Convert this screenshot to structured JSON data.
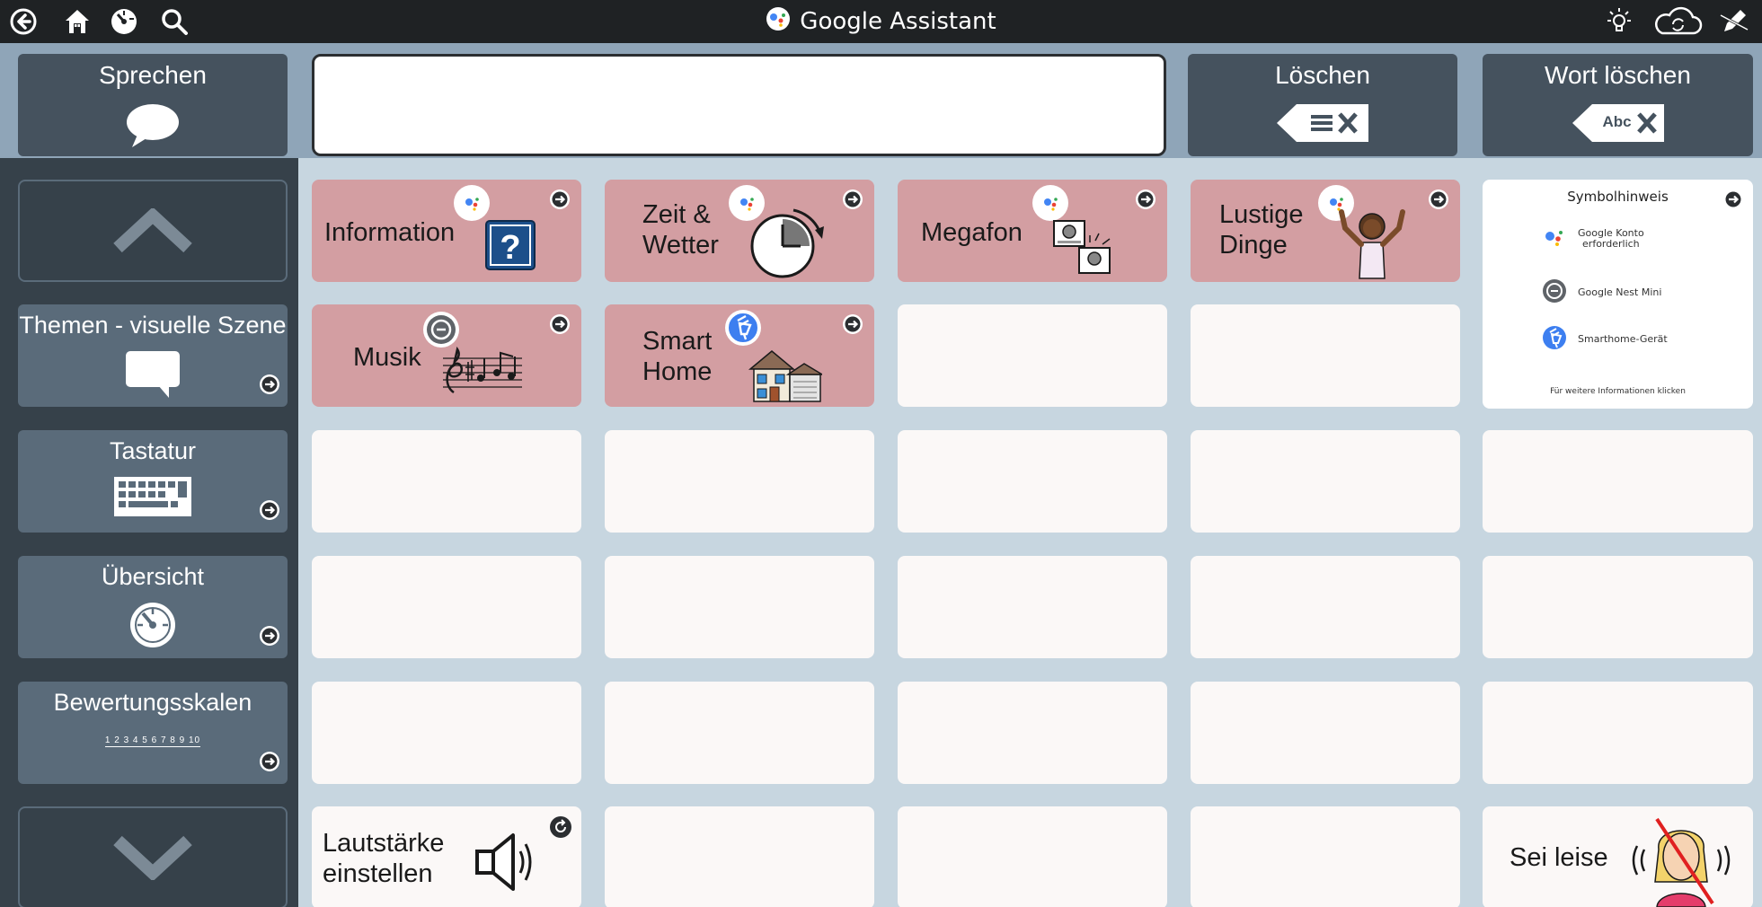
{
  "titlebar": {
    "title": "Google Assistant",
    "left_icons": [
      "back-arrow-icon",
      "home-icon",
      "dashboard-icon",
      "search-icon"
    ],
    "right_icons": [
      "lightbulb-icon",
      "cloud-sync-icon",
      "edit-pencil-icon"
    ]
  },
  "topbar": {
    "speak_label": "Sprechen",
    "message_value": "",
    "clear_label": "Löschen",
    "clear_word_label": "Wort löschen",
    "clear_word_icon_text": "Abc"
  },
  "sidebar": {
    "up": "chevron-up-icon",
    "down": "chevron-down-icon",
    "items": [
      {
        "label": "Themen - visuelle Szene"
      },
      {
        "label": "Tastatur"
      },
      {
        "label": "Übersicht"
      },
      {
        "label": "Bewertungsskalen",
        "scale_text": "1 2 3 4 5 6 7 8 9 10"
      }
    ]
  },
  "grid": {
    "information": "Information",
    "time_weather_1": "Zeit &",
    "time_weather_2": "Wetter",
    "megaphone": "Megafon",
    "funny_1": "Lustige",
    "funny_2": "Dinge",
    "music": "Musik",
    "smart_home_1": "Smart",
    "smart_home_2": "Home",
    "volume_1": "Lautstärke",
    "volume_2": "einstellen",
    "quiet": "Sei leise"
  },
  "legend": {
    "title": "Symbolhinweis",
    "account_1": "Google Konto",
    "account_2": "erforderlich",
    "nest": "Google Nest Mini",
    "smarthome": "Smarthome-Gerät",
    "footer": "Für weitere Informationen klicken"
  },
  "colors": {
    "titlebar": "#1f2224",
    "topstrip": "#8fa5b8",
    "sidebar": "#36414a",
    "button": "#45525e",
    "category_cell": "#d39ea2",
    "empty_cell": "#fbf8f7",
    "background": "#c7d6e0"
  }
}
